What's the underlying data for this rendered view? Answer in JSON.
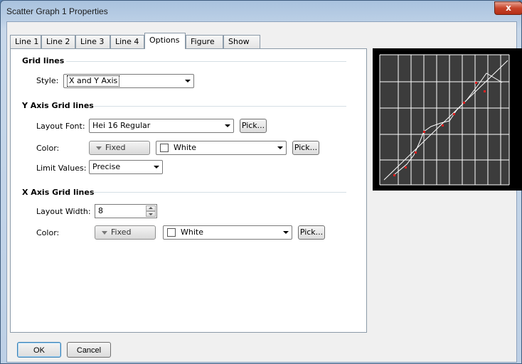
{
  "window": {
    "title": "Scatter Graph 1 Properties",
    "close_label": "x"
  },
  "tabs": [
    {
      "label": "Line 1",
      "active": false
    },
    {
      "label": "Line 2",
      "active": false
    },
    {
      "label": "Line 3",
      "active": false
    },
    {
      "label": "Line 4",
      "active": false
    },
    {
      "label": "Options",
      "active": true
    },
    {
      "label": "Figure",
      "active": false
    },
    {
      "label": "Show",
      "active": false
    }
  ],
  "grid_lines": {
    "section_title": "Grid lines",
    "style_label": "Style:",
    "style_value": "X and Y Axis"
  },
  "y_axis": {
    "section_title": "Y Axis Grid lines",
    "layout_font_label": "Layout Font:",
    "layout_font_value": "Hei 16 Regular",
    "pick_label": "Pick...",
    "color_label": "Color:",
    "color_mode": "Fixed",
    "color_value": "White",
    "color_pick_label": "Pick...",
    "limit_values_label": "Limit Values:",
    "limit_values_value": "Precise"
  },
  "x_axis": {
    "section_title": "X Axis Grid lines",
    "layout_width_label": "Layout Width:",
    "layout_width_value": "8",
    "color_label": "Color:",
    "color_mode": "Fixed",
    "color_value": "White",
    "color_pick_label": "Pick..."
  },
  "footer": {
    "ok_label": "OK",
    "cancel_label": "Cancel"
  },
  "colors": {
    "preview_background": "#3c3c3c",
    "grid_line": "#ffffff",
    "marker": "#e02020"
  }
}
